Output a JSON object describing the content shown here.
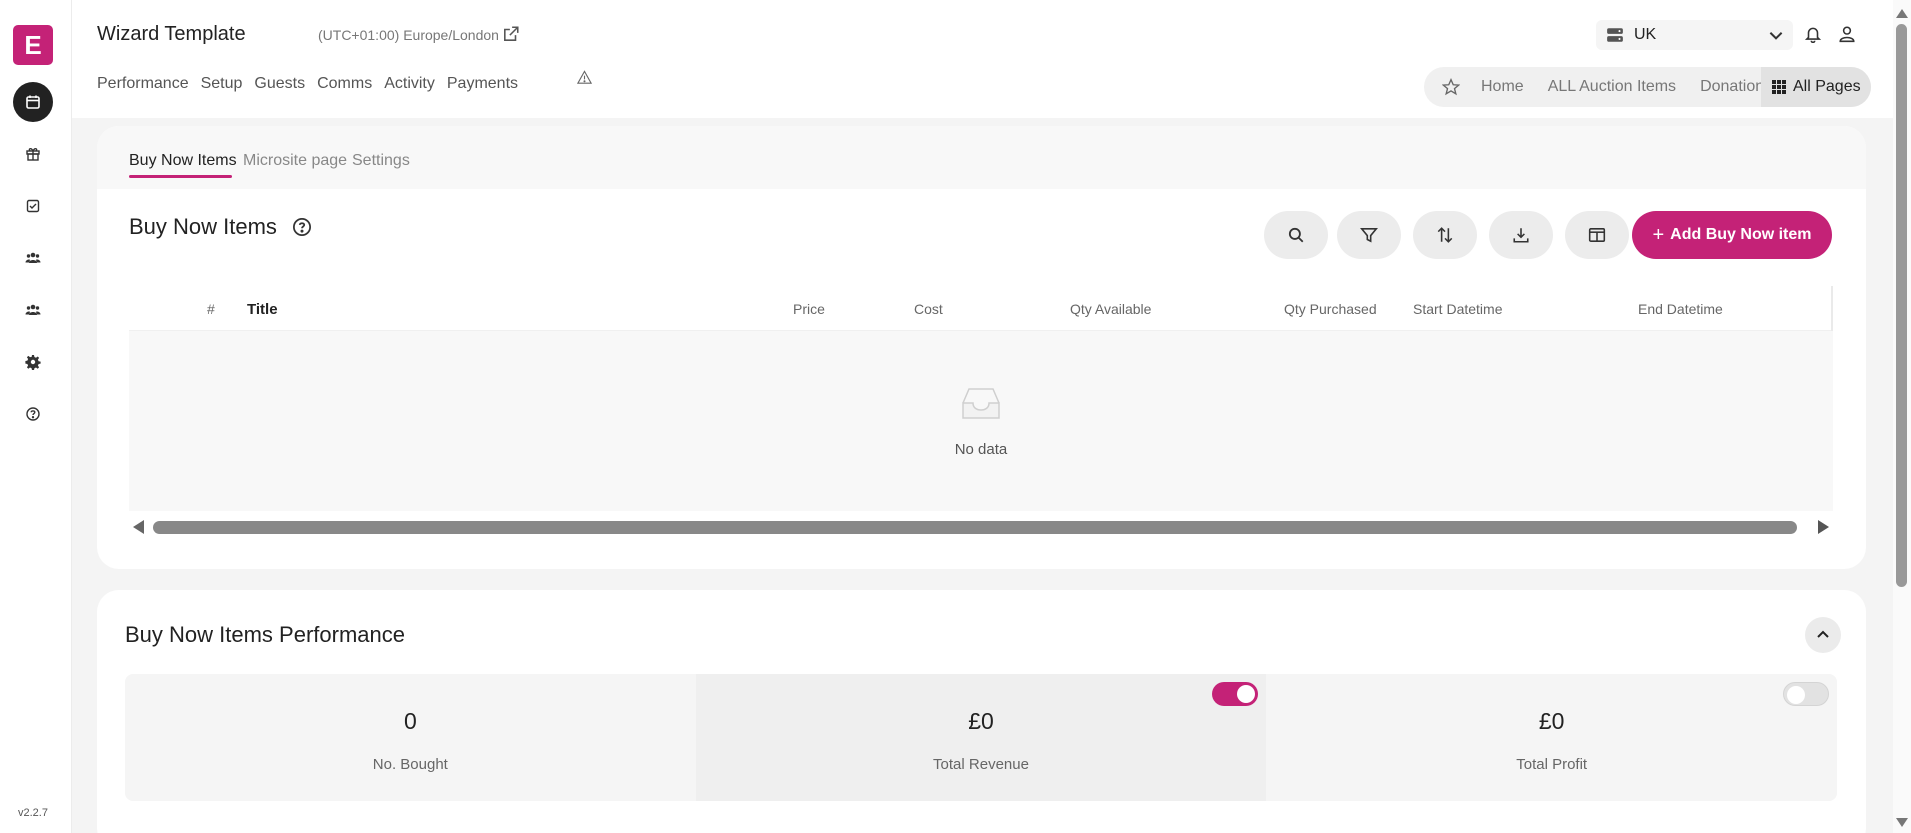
{
  "sidebar": {
    "logo_letter": "E",
    "version": "v2.2.7",
    "items": [
      {
        "icon": "calendar-icon",
        "active": true
      },
      {
        "icon": "gift-icon"
      },
      {
        "icon": "checkbox-icon"
      },
      {
        "icon": "users-icon"
      },
      {
        "icon": "users-group-icon"
      },
      {
        "icon": "gear-icon"
      },
      {
        "icon": "help-circle-icon"
      }
    ]
  },
  "header": {
    "title": "Wizard Template",
    "timezone": "(UTC+01:00) Europe/London",
    "nav": [
      "Performance",
      "Setup",
      "Guests",
      "Comms",
      "Activity",
      "Payments"
    ],
    "region": "UK",
    "quick_links": [
      "Home",
      "ALL Auction Items",
      "Donation"
    ],
    "all_pages": "All Pages"
  },
  "tabs": [
    "Buy Now Items",
    "Microsite page",
    "Settings"
  ],
  "list": {
    "title": "Buy Now Items",
    "add_button": "Add Buy Now item",
    "columns": [
      "#",
      "Title",
      "Price",
      "Cost",
      "Qty Available",
      "Qty Purchased",
      "Start Datetime",
      "End Datetime"
    ],
    "empty_text": "No data"
  },
  "performance": {
    "title": "Buy Now Items Performance",
    "stats": [
      {
        "value": "0",
        "label": "No. Bought"
      },
      {
        "value": "£0",
        "label": "Total Revenue",
        "toggle_on": true
      },
      {
        "value": "£0",
        "label": "Total Profit",
        "toggle_on": false
      }
    ]
  },
  "colors": {
    "accent": "#c42277"
  }
}
